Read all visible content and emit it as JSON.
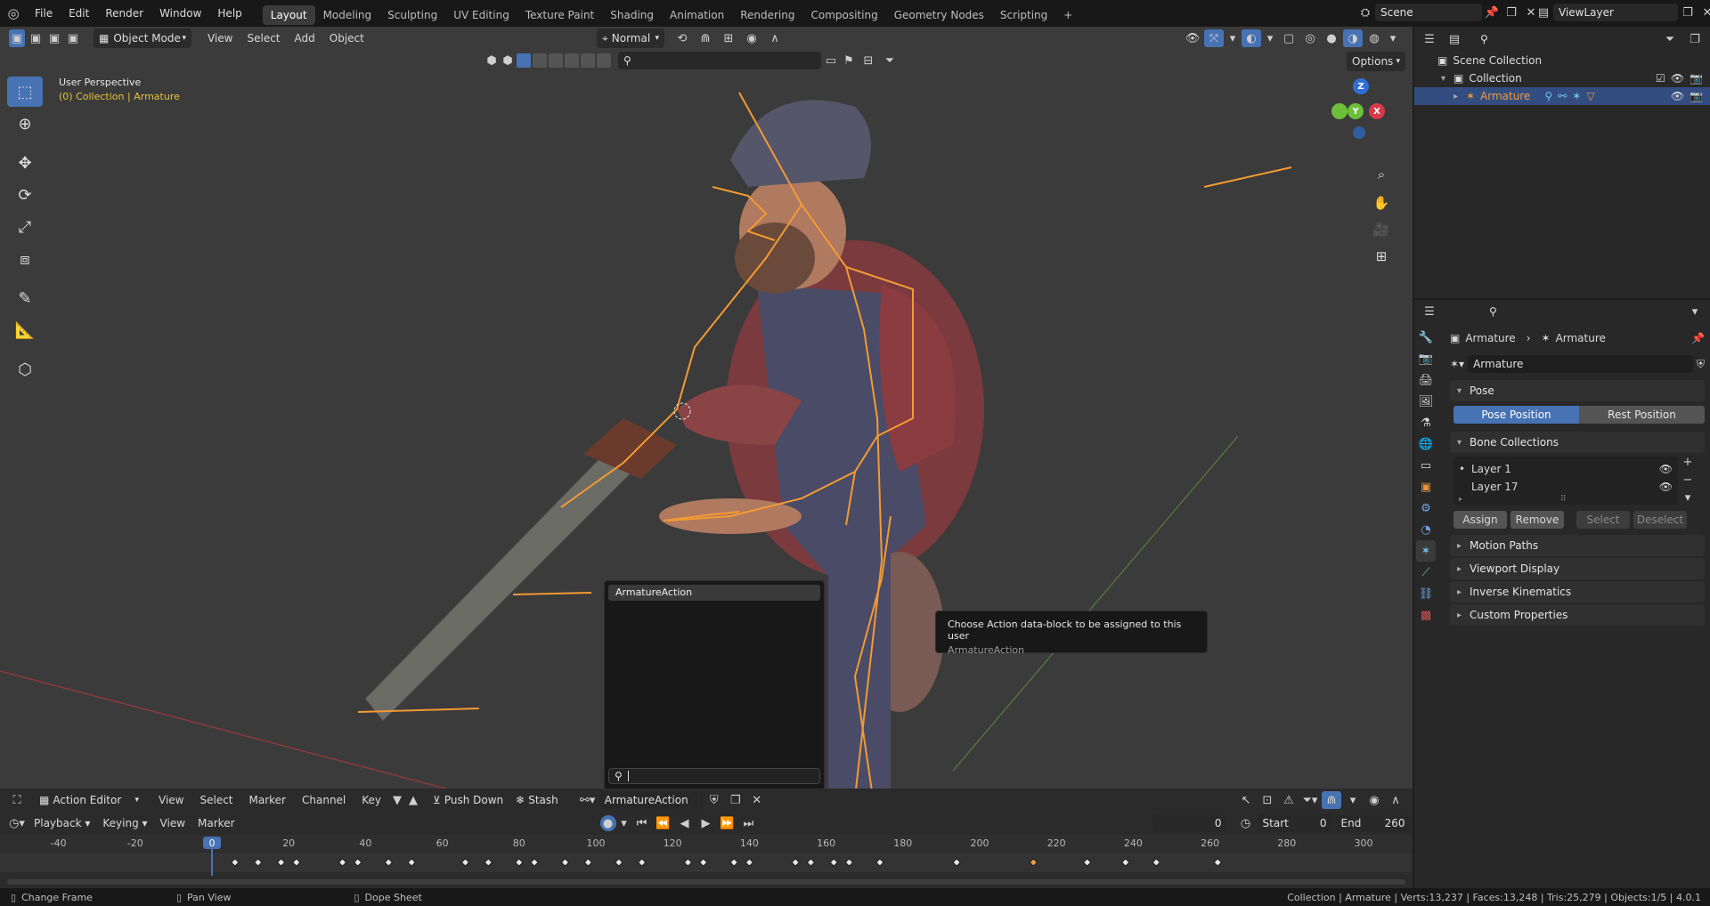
{
  "topbar": {
    "menus": [
      "File",
      "Edit",
      "Render",
      "Window",
      "Help"
    ],
    "workspaces": [
      "Layout",
      "Modeling",
      "Sculpting",
      "UV Editing",
      "Texture Paint",
      "Shading",
      "Animation",
      "Rendering",
      "Compositing",
      "Geometry Nodes",
      "Scripting"
    ],
    "active_workspace": "Layout",
    "add_tab": "+",
    "scene": "Scene",
    "view_layer": "ViewLayer"
  },
  "viewport": {
    "mode": "Object Mode",
    "menus": [
      "View",
      "Select",
      "Add",
      "Object"
    ],
    "orientation": "Normal",
    "options": "Options",
    "overlay_title": "User Perspective",
    "overlay_collection": "(0) Collection",
    "overlay_separator": "|",
    "overlay_object": "Armature",
    "gizmo": {
      "x": "X",
      "y": "Y",
      "z": "Z"
    }
  },
  "popup": {
    "item": "ArmatureAction",
    "search_placeholder": ""
  },
  "tooltip": {
    "line1": "Choose Action data-block to be assigned to this user",
    "line2": "ArmatureAction"
  },
  "outliner": {
    "search_placeholder": "",
    "rows": [
      {
        "label": "Scene Collection"
      },
      {
        "label": "Collection"
      },
      {
        "label": "Armature"
      }
    ]
  },
  "properties": {
    "breadcrumb_object": "Armature",
    "breadcrumb_data": "Armature",
    "datablock": "Armature",
    "pose_panel": "Pose",
    "pose_position": "Pose Position",
    "rest_position": "Rest Position",
    "bone_collections_panel": "Bone Collections",
    "layers": [
      "Layer 1",
      "Layer 17"
    ],
    "assign": "Assign",
    "remove": "Remove",
    "select": "Select",
    "deselect": "Deselect",
    "collapsed_panels": [
      "Motion Paths",
      "Viewport Display",
      "Inverse Kinematics",
      "Custom Properties"
    ]
  },
  "dopesheet": {
    "editor": "Action Editor",
    "menus": [
      "View",
      "Select",
      "Marker",
      "Channel",
      "Key"
    ],
    "push_down": "Push Down",
    "stash": "Stash",
    "action": "ArmatureAction",
    "playback": "Playback",
    "keying": "Keying",
    "view": "View",
    "marker": "Marker",
    "current_frame": "0",
    "start_label": "Start",
    "start_value": "0",
    "end_label": "End",
    "end_value": "260",
    "ruler": [
      "-40",
      "-20",
      "0",
      "20",
      "40",
      "60",
      "80",
      "100",
      "120",
      "140",
      "160",
      "180",
      "200",
      "220",
      "240",
      "260",
      "280",
      "300"
    ],
    "keyframes": [
      6,
      12,
      18,
      22,
      34,
      38,
      46,
      52,
      66,
      72,
      80,
      84,
      92,
      98,
      106,
      112,
      124,
      128,
      136,
      140,
      152,
      156,
      162,
      166,
      174,
      194,
      214,
      228,
      238,
      246,
      262
    ],
    "selected_keyframe": 214
  },
  "statusbar": {
    "change_frame": "Change Frame",
    "pan_view": "Pan View",
    "dope_sheet": "Dope Sheet",
    "stats": "Collection | Armature | Verts:13,237 | Faces:13,248 | Tris:25,279 | Objects:1/5 | 4.0.1"
  },
  "colors": {
    "accent": "#4772b3",
    "bone": "#f39a33",
    "selected_key": "#e8a13a"
  }
}
